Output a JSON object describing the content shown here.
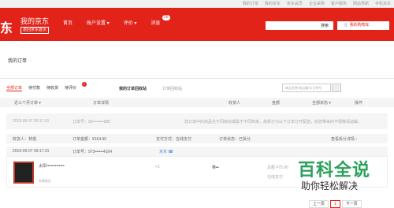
{
  "topbar": {
    "links": [
      "我的订单",
      "我的京东",
      "京东会员",
      "企业采购",
      "客户服务",
      "网站导航",
      "手机京东"
    ]
  },
  "header": {
    "logo": "东",
    "title": "我的京东",
    "back_home": "返回京东首页",
    "nav": [
      "首页",
      "账户设置 ▾",
      "评价 ▾",
      "消息"
    ],
    "msg_badge": "26",
    "search_button": "搜索",
    "cart_label": "我的购物车"
  },
  "breadcrumb": "我的订单",
  "tabs": {
    "items": [
      "全部订单",
      "待付款",
      "待收货",
      "待评价"
    ],
    "pending_badge": "1",
    "recycle": "我的订单回收站",
    "history": "订单回收站",
    "search_placeholder": "商品名称/商品编号/订单号"
  },
  "table_head": {
    "range": "近三个月订单 ▾",
    "details": "订单详情",
    "receiver": "收货人",
    "amount": "金额",
    "status": "全部状态 ▾",
    "ops": "操作"
  },
  "order1": {
    "date": "2019-06-07 09:17:31",
    "no": "订单号：96••••••••580",
    "note": "您订单中的商品在不同库房或属于不同商家，故拆分为以下订单分开配送，给您带来的不便敬请谅解。"
  },
  "order2": {
    "receiver": "收货人：林煜",
    "amount": "订单金额：¥164.90",
    "pay": "支付方式：在线支付",
    "state": "订单状态：已拆分",
    "more": "查看拆分详情 ›"
  },
  "order3": {
    "date": "2019-06-07 09:17:31",
    "no": "订单号：973••••••4164",
    "shop": "京东 ☎"
  },
  "item": {
    "name": "太阳•••••••••••••",
    "link": "申请售后",
    "qty": "×1",
    "status": "林••",
    "price": "总额 ¥75.90",
    "pay": "在线支付"
  },
  "watermark": {
    "big": "百科全说",
    "small": "助你轻松解决"
  },
  "pager": [
    "上一页",
    "1",
    "下一页"
  ]
}
